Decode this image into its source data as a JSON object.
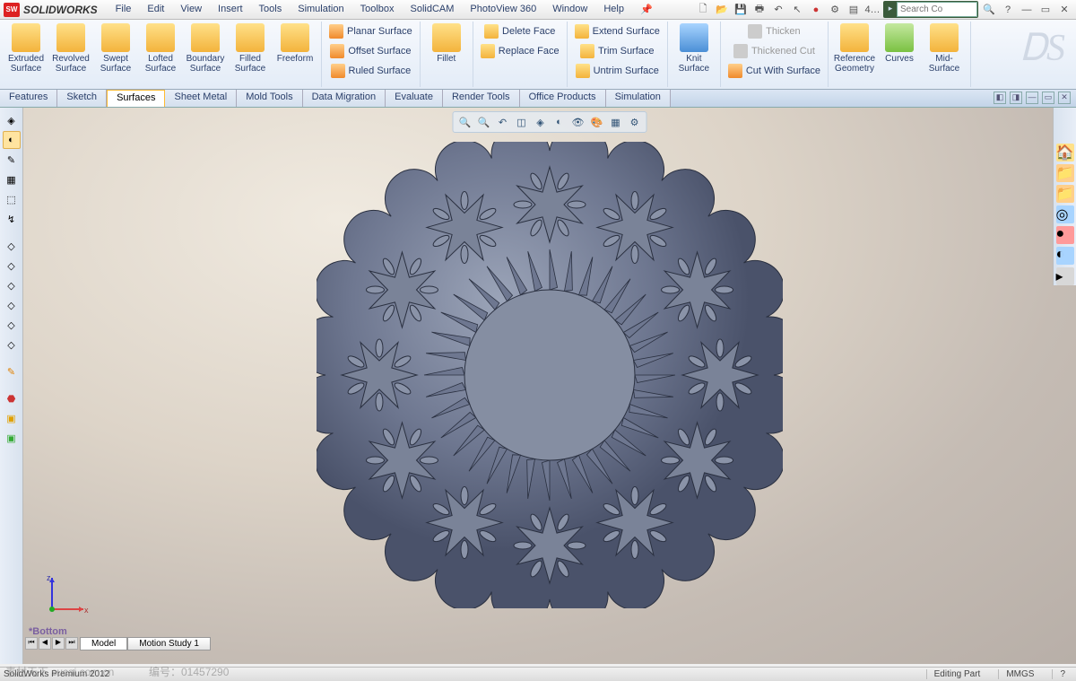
{
  "app": {
    "name": "SOLIDWORKS"
  },
  "menu": [
    "File",
    "Edit",
    "View",
    "Insert",
    "Tools",
    "Simulation",
    "Toolbox",
    "SolidCAM",
    "PhotoView 360",
    "Window",
    "Help"
  ],
  "search": {
    "placeholder": "Search Co"
  },
  "ribbon": {
    "big": [
      {
        "label": "Extruded Surface"
      },
      {
        "label": "Revolved Surface"
      },
      {
        "label": "Swept Surface"
      },
      {
        "label": "Lofted Surface"
      },
      {
        "label": "Boundary Surface"
      },
      {
        "label": "Filled Surface"
      },
      {
        "label": "Freeform"
      }
    ],
    "col1": [
      "Planar Surface",
      "Offset Surface",
      "Ruled Surface"
    ],
    "fillet": "Fillet",
    "col2": [
      "Delete Face",
      "Replace Face"
    ],
    "col3": [
      "Extend Surface",
      "Trim Surface",
      "Untrim Surface"
    ],
    "knit": "Knit Surface",
    "col4": [
      "Thicken",
      "Thickened Cut",
      "Cut With Surface"
    ],
    "ref": "Reference Geometry",
    "curves": "Curves",
    "mid": "Mid-Surface"
  },
  "tabs": [
    "Features",
    "Sketch",
    "Surfaces",
    "Sheet Metal",
    "Mold Tools",
    "Data Migration",
    "Evaluate",
    "Render Tools",
    "Office Products",
    "Simulation"
  ],
  "active_tab": "Surfaces",
  "orientation": "*Bottom",
  "triad": {
    "x": "x",
    "z": "z"
  },
  "doc_tabs": [
    "Model",
    "Motion Study 1"
  ],
  "status": {
    "left": "SolidWorks Premium 2012",
    "edit": "Editing Part",
    "units": "MMGS"
  },
  "watermark": {
    "a": "素材天下 sucai.com.cn",
    "b": "编号：01457290"
  }
}
